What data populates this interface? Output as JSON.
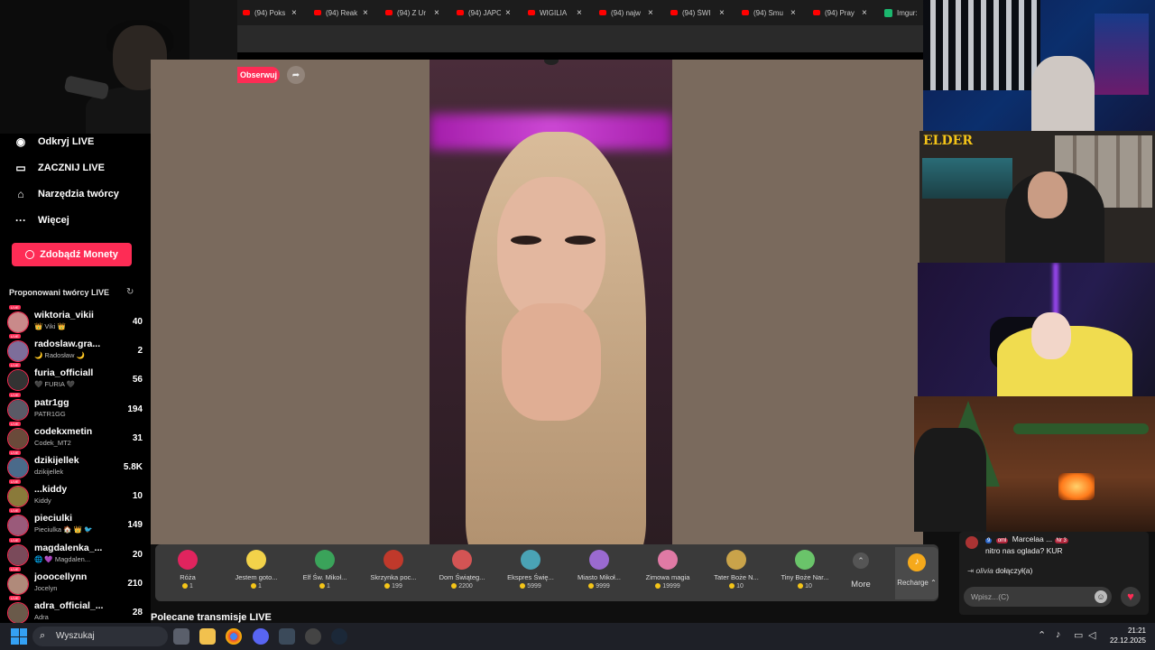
{
  "browser": {
    "tabs": [
      {
        "title": "(94) Poks",
        "icon": "youtube"
      },
      {
        "title": "(94) Reak",
        "icon": "youtube"
      },
      {
        "title": "(94) Z Ur",
        "icon": "youtube"
      },
      {
        "title": "(94) JAPO",
        "icon": "youtube"
      },
      {
        "title": "WIGILIA",
        "icon": "youtube"
      },
      {
        "title": "(94) najw",
        "icon": "youtube"
      },
      {
        "title": "(94) ŚWI",
        "icon": "youtube"
      },
      {
        "title": "(94) Smu",
        "icon": "youtube"
      },
      {
        "title": "(94) Pray",
        "icon": "youtube"
      },
      {
        "title": "Imgur:",
        "icon": "imgur"
      }
    ]
  },
  "sidebar": {
    "nav": [
      {
        "label": "Odkryj LIVE",
        "icon": "live-icon"
      },
      {
        "label": "ZACZNIJ LIVE",
        "icon": "camera-icon"
      },
      {
        "label": "Narzędzia twórcy",
        "icon": "home-icon"
      },
      {
        "label": "Więcej",
        "icon": "more-icon"
      }
    ],
    "coins_button": "Zdobądź Monety",
    "suggested_title": "Proponowani twórcy LIVE",
    "creators": [
      {
        "name": "wiktoria_vikii",
        "sub": "👑 Viki 👑",
        "count": "40",
        "color": "#c98a8a"
      },
      {
        "name": "radoslaw.gra...",
        "sub": "🌙 Radosław 🌙",
        "count": "2",
        "color": "#7d6e9a"
      },
      {
        "name": "furia_officiall",
        "sub": "🖤 FURIA 🖤",
        "count": "56",
        "color": "#333333"
      },
      {
        "name": "patr1gg",
        "sub": "PATR1GG",
        "count": "194",
        "color": "#5a5a66"
      },
      {
        "name": "codekxmetin",
        "sub": "Codek_MT2",
        "count": "31",
        "color": "#6a4a3a"
      },
      {
        "name": "dzikijellek",
        "sub": "dzikijellek",
        "count": "5.8K",
        "color": "#4a6a8a"
      },
      {
        "name": "...kiddy",
        "sub": "Kiddy",
        "count": "10",
        "color": "#8a7a3a"
      },
      {
        "name": "pieciulki",
        "sub": "Pieciulka 🏠 👑 🐦",
        "count": "149",
        "color": "#9a5a7a"
      },
      {
        "name": "magdalenka_...",
        "sub": "🌐 💜 Magdalen...",
        "count": "20",
        "color": "#7a4a5a"
      },
      {
        "name": "jooocellynn",
        "sub": "Jocelyn",
        "count": "210",
        "color": "#b08a7a"
      },
      {
        "name": "adra_official_...",
        "sub": "Adra",
        "count": "28",
        "color": "#6a5a4a"
      }
    ]
  },
  "stream": {
    "follow_label": "Obserwuj",
    "share_icon": "share-icon"
  },
  "gifts": [
    {
      "name": "Róża",
      "price": "1",
      "color": "#e0245e"
    },
    {
      "name": "Jestem goto...",
      "price": "1",
      "color": "#f2d24a"
    },
    {
      "name": "Elf Św. Mikoł...",
      "price": "1",
      "color": "#3aa35a"
    },
    {
      "name": "Skrzynka poc...",
      "price": "199",
      "color": "#c0392b"
    },
    {
      "name": "Dom Świąteg...",
      "price": "2200",
      "color": "#d35454"
    },
    {
      "name": "Ekspres Świę...",
      "price": "5999",
      "color": "#4aa3b5"
    },
    {
      "name": "Miasto Mikoł...",
      "price": "9999",
      "color": "#9a6ad0"
    },
    {
      "name": "Zimowa magia",
      "price": "19999",
      "color": "#e07aa5"
    },
    {
      "name": "Tater Boże N...",
      "price": "10",
      "color": "#c9a34a"
    },
    {
      "name": "Tiny Boże Nar...",
      "price": "10",
      "color": "#6ac46a"
    }
  ],
  "gift_more_label": "More",
  "recharge_label": "Recharge ⌃",
  "recommended_heading": "Polecane transmisje LIVE",
  "chat": {
    "line1_badge": "9",
    "line1_badge2": "oml",
    "line1_user": "Marcelaa ...",
    "line1_rank": "Nr 3",
    "line2": "nitro nas oglada? KUR",
    "line3_user": "olivia",
    "line3_text": "dołączył(a)",
    "input_placeholder": "Wpisz...(C)"
  },
  "cam_logo": "ELDER",
  "taskbar": {
    "search_placeholder": "Wyszukaj",
    "time": "21:21",
    "date": "22.12.2025"
  }
}
